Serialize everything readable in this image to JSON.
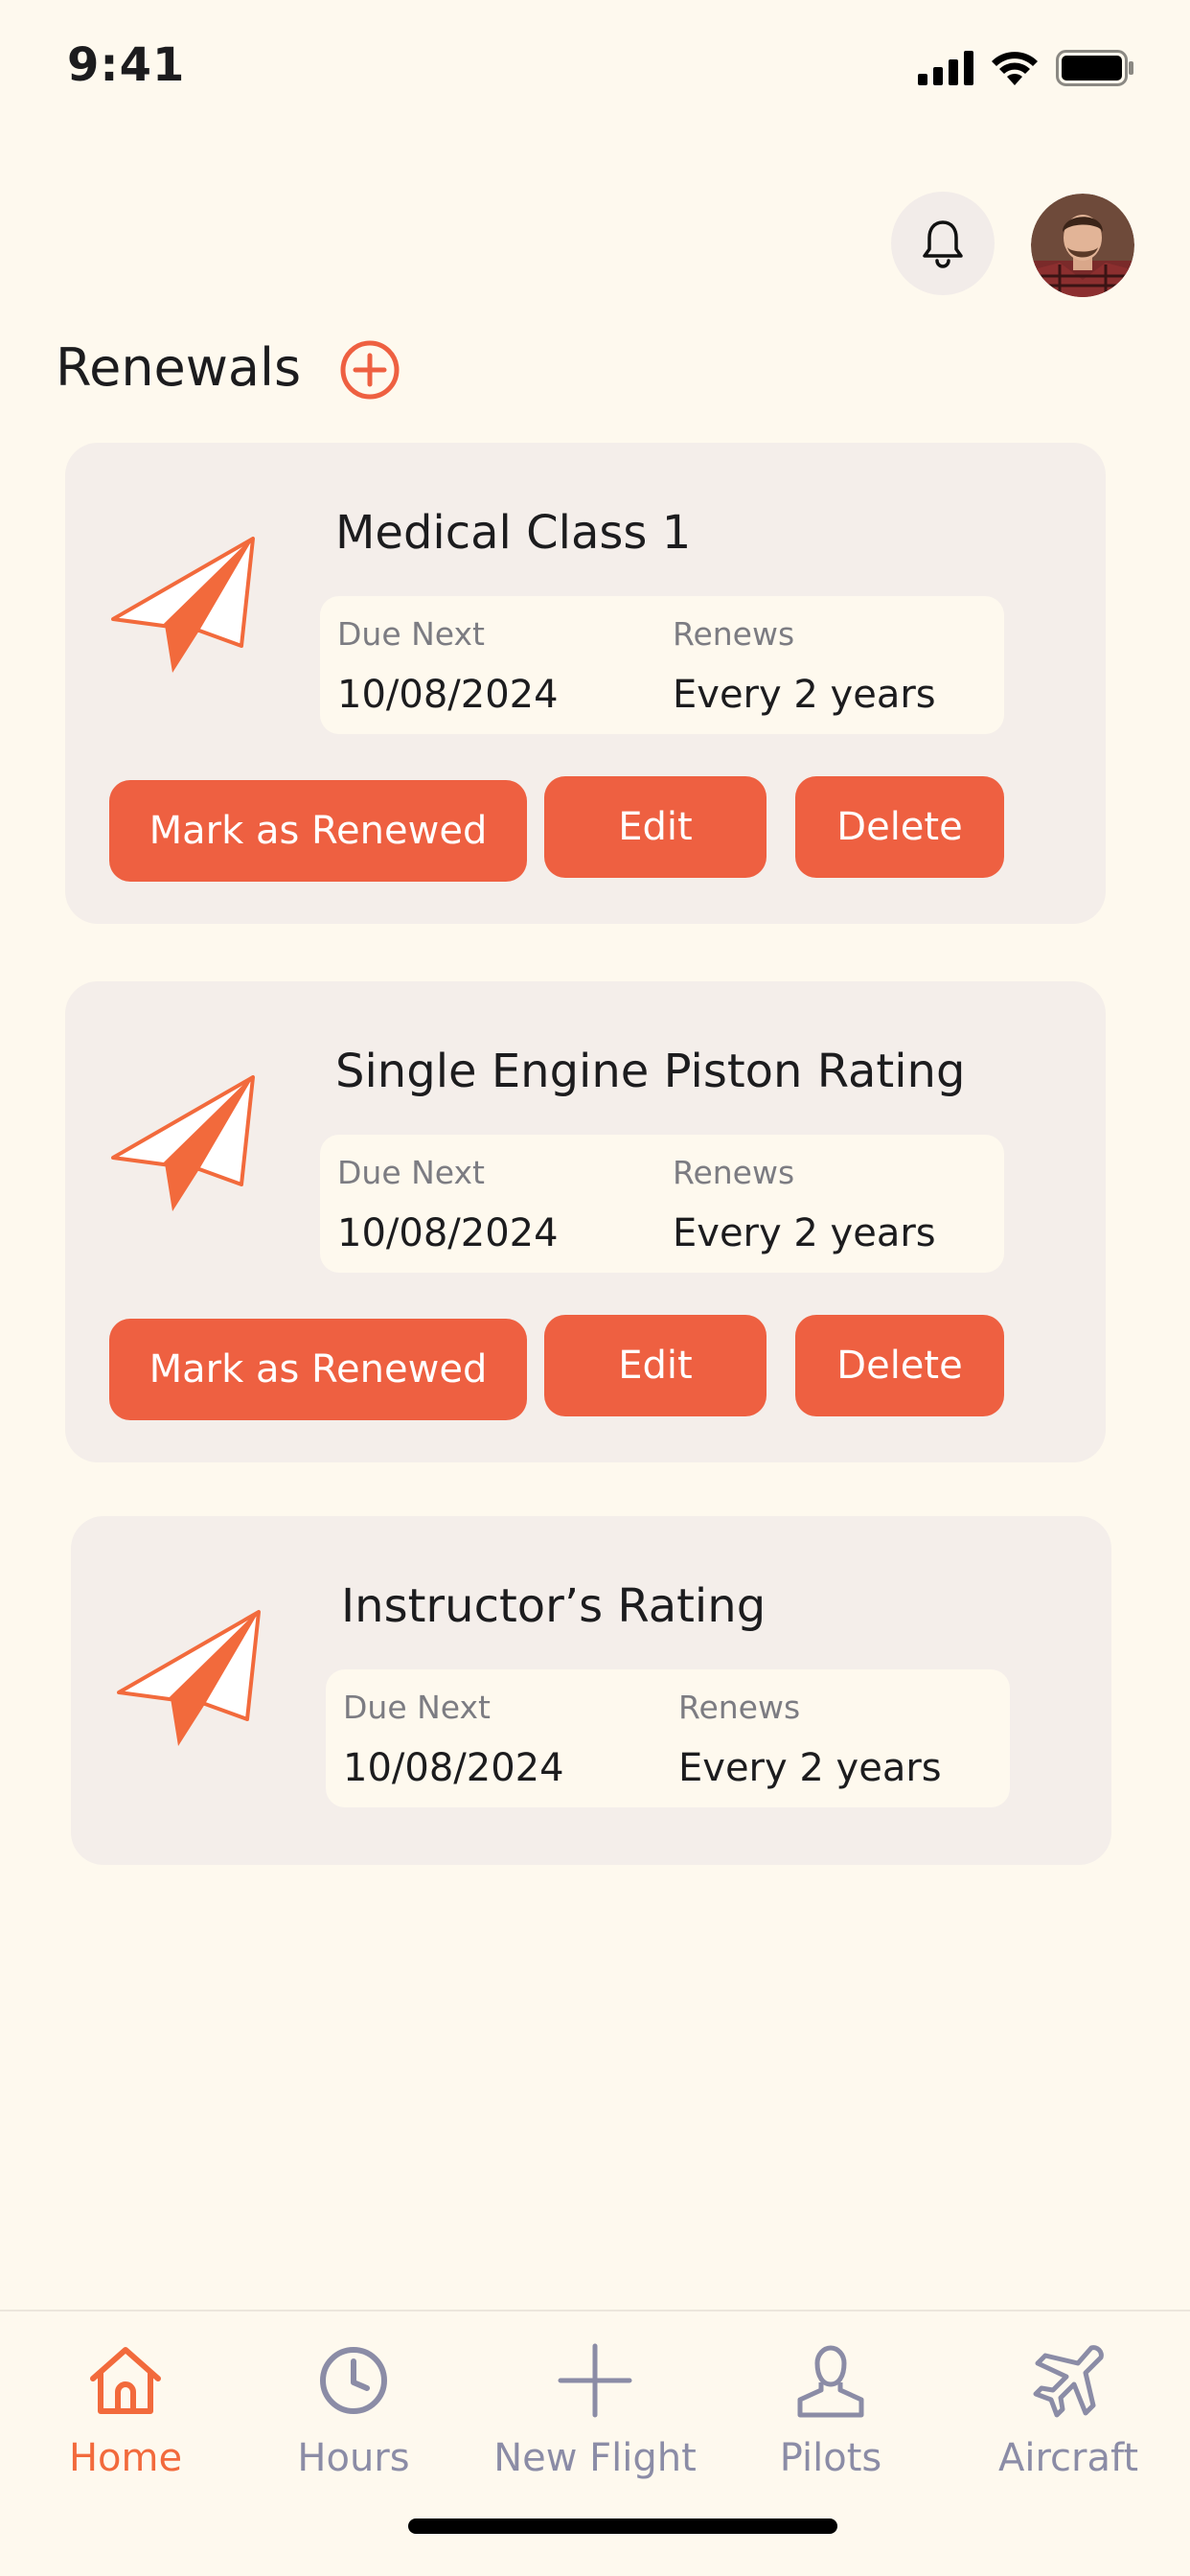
{
  "status_bar": {
    "time": "9:41"
  },
  "header": {
    "notifications_icon": "bell-icon",
    "avatar_icon": "user-avatar"
  },
  "section": {
    "title": "Renewals",
    "add_icon": "plus-circle-icon"
  },
  "colors": {
    "accent": "#EE6041",
    "background": "#FEF9EE",
    "card": "#F4EEEA",
    "tab_active": "#F26A3C",
    "tab_inactive": "#8b8ca6"
  },
  "renewals": [
    {
      "title": "Medical Class 1",
      "due_label": "Due Next",
      "due_value": "10/08/2024",
      "renews_label": "Renews",
      "renews_value": "Every 2 years",
      "mark_label": "Mark as Renewed",
      "edit_label": "Edit",
      "delete_label": "Delete"
    },
    {
      "title": "Single Engine Piston Rating",
      "due_label": "Due Next",
      "due_value": "10/08/2024",
      "renews_label": "Renews",
      "renews_value": "Every 2 years",
      "mark_label": "Mark as Renewed",
      "edit_label": "Edit",
      "delete_label": "Delete"
    },
    {
      "title": "Instructor’s Rating",
      "due_label": "Due Next",
      "due_value": "10/08/2024",
      "renews_label": "Renews",
      "renews_value": "Every 2 years"
    }
  ],
  "tabbar": {
    "items": [
      {
        "label": "Home",
        "icon": "home-icon",
        "active": true
      },
      {
        "label": "Hours",
        "icon": "clock-icon",
        "active": false
      },
      {
        "label": "New Flight",
        "icon": "plus-icon",
        "active": false
      },
      {
        "label": "Pilots",
        "icon": "person-icon",
        "active": false
      },
      {
        "label": "Aircraft",
        "icon": "airplane-icon",
        "active": false
      }
    ]
  }
}
